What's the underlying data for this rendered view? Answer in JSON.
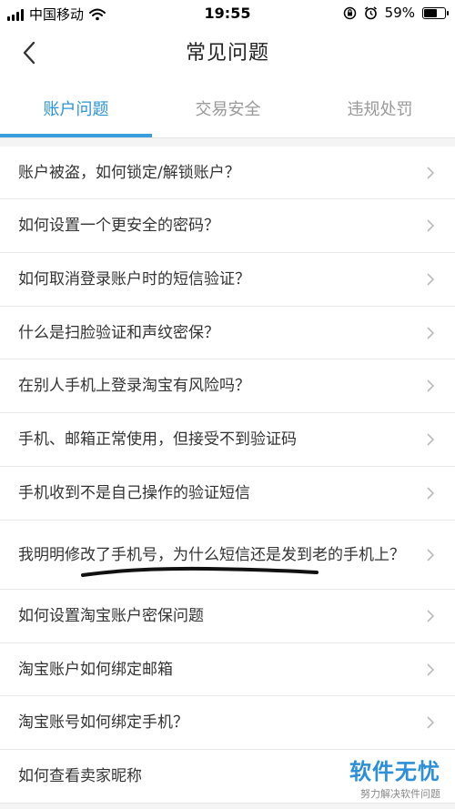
{
  "status_bar": {
    "carrier": "中国移动",
    "time": "19:55",
    "battery_text": "59%",
    "battery_level": 0.59,
    "icons": [
      "signal-icon",
      "wifi-icon",
      "rotation-lock-icon",
      "alarm-icon",
      "battery-icon"
    ]
  },
  "header": {
    "back_icon": "chevron-left-icon",
    "title": "常见问题"
  },
  "tabs": [
    {
      "label": "账户问题",
      "active": true
    },
    {
      "label": "交易安全",
      "active": false
    },
    {
      "label": "违规处罚",
      "active": false
    }
  ],
  "accent_color": "#2c95d6",
  "faq": {
    "items": [
      {
        "label": "账户被盗，如何锁定/解锁账户？"
      },
      {
        "label": "如何设置一个更安全的密码？"
      },
      {
        "label": "如何取消登录账户时的短信验证？"
      },
      {
        "label": "什么是扫脸验证和声纹密保？"
      },
      {
        "label": "在别人手机上登录淘宝有风险吗？"
      },
      {
        "label": "手机、邮箱正常使用，但接受不到验证码"
      },
      {
        "label": "手机收到不是自己操作的验证短信"
      },
      {
        "label": "我明明修改了手机号，为什么短信还是发到老的手机上？"
      },
      {
        "label": "如何设置淘宝账户密保问题"
      },
      {
        "label": "淘宝账户如何绑定邮箱"
      },
      {
        "label": "淘宝账号如何绑定手机？"
      },
      {
        "label": "如何查看卖家昵称"
      }
    ]
  },
  "watermark": {
    "logo": "软件无忧",
    "tagline": "努力解决软件问题"
  }
}
